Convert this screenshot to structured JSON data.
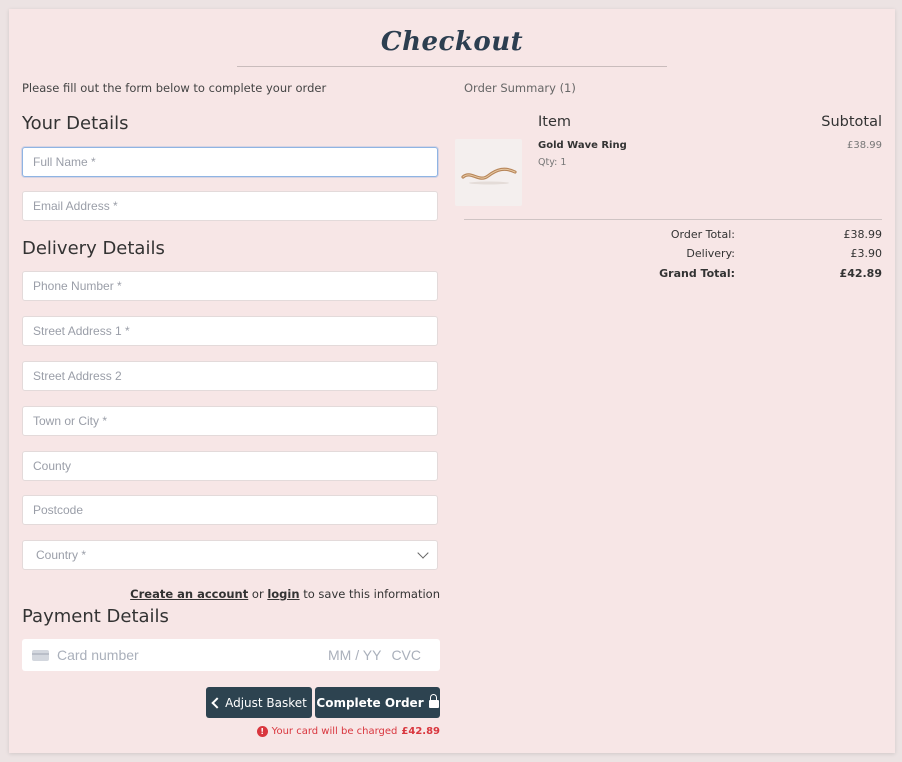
{
  "page": {
    "title": "Checkout",
    "intro": "Please fill out the form below to complete your order"
  },
  "your_details": {
    "heading": "Your Details",
    "full_name_placeholder": "Full Name *",
    "email_placeholder": "Email Address *"
  },
  "delivery": {
    "heading": "Delivery Details",
    "phone_placeholder": "Phone Number *",
    "street1_placeholder": "Street Address 1 *",
    "street2_placeholder": "Street Address 2",
    "town_placeholder": "Town or City *",
    "county_placeholder": "County",
    "postcode_placeholder": "Postcode",
    "country_value": "Country *"
  },
  "account": {
    "create_label": "Create an account",
    "or": "or",
    "login_label": "login",
    "suffix": "to save this information"
  },
  "payment": {
    "heading": "Payment Details",
    "card_number_placeholder": "Card number",
    "expiry_placeholder": "MM / YY",
    "cvc_placeholder": "CVC"
  },
  "buttons": {
    "adjust_label": "Adjust Basket",
    "complete_label": "Complete Order"
  },
  "charge": {
    "text": "Your card will be charged",
    "amount": "£42.89"
  },
  "summary": {
    "heading": "Order Summary (1)",
    "item_col": "Item",
    "subtotal_col": "Subtotal",
    "items": [
      {
        "name": "Gold Wave Ring",
        "qty": "Qty: 1",
        "price": "£38.99"
      }
    ],
    "order_total_label": "Order Total:",
    "order_total": "£38.99",
    "delivery_label": "Delivery:",
    "delivery": "£3.90",
    "grand_total_label": "Grand Total:",
    "grand_total": "£42.89"
  },
  "colors": {
    "page_bg": "#f7e6e6",
    "button_bg": "#2d4350",
    "error": "#d9363e",
    "heading": "#2c3e50"
  }
}
